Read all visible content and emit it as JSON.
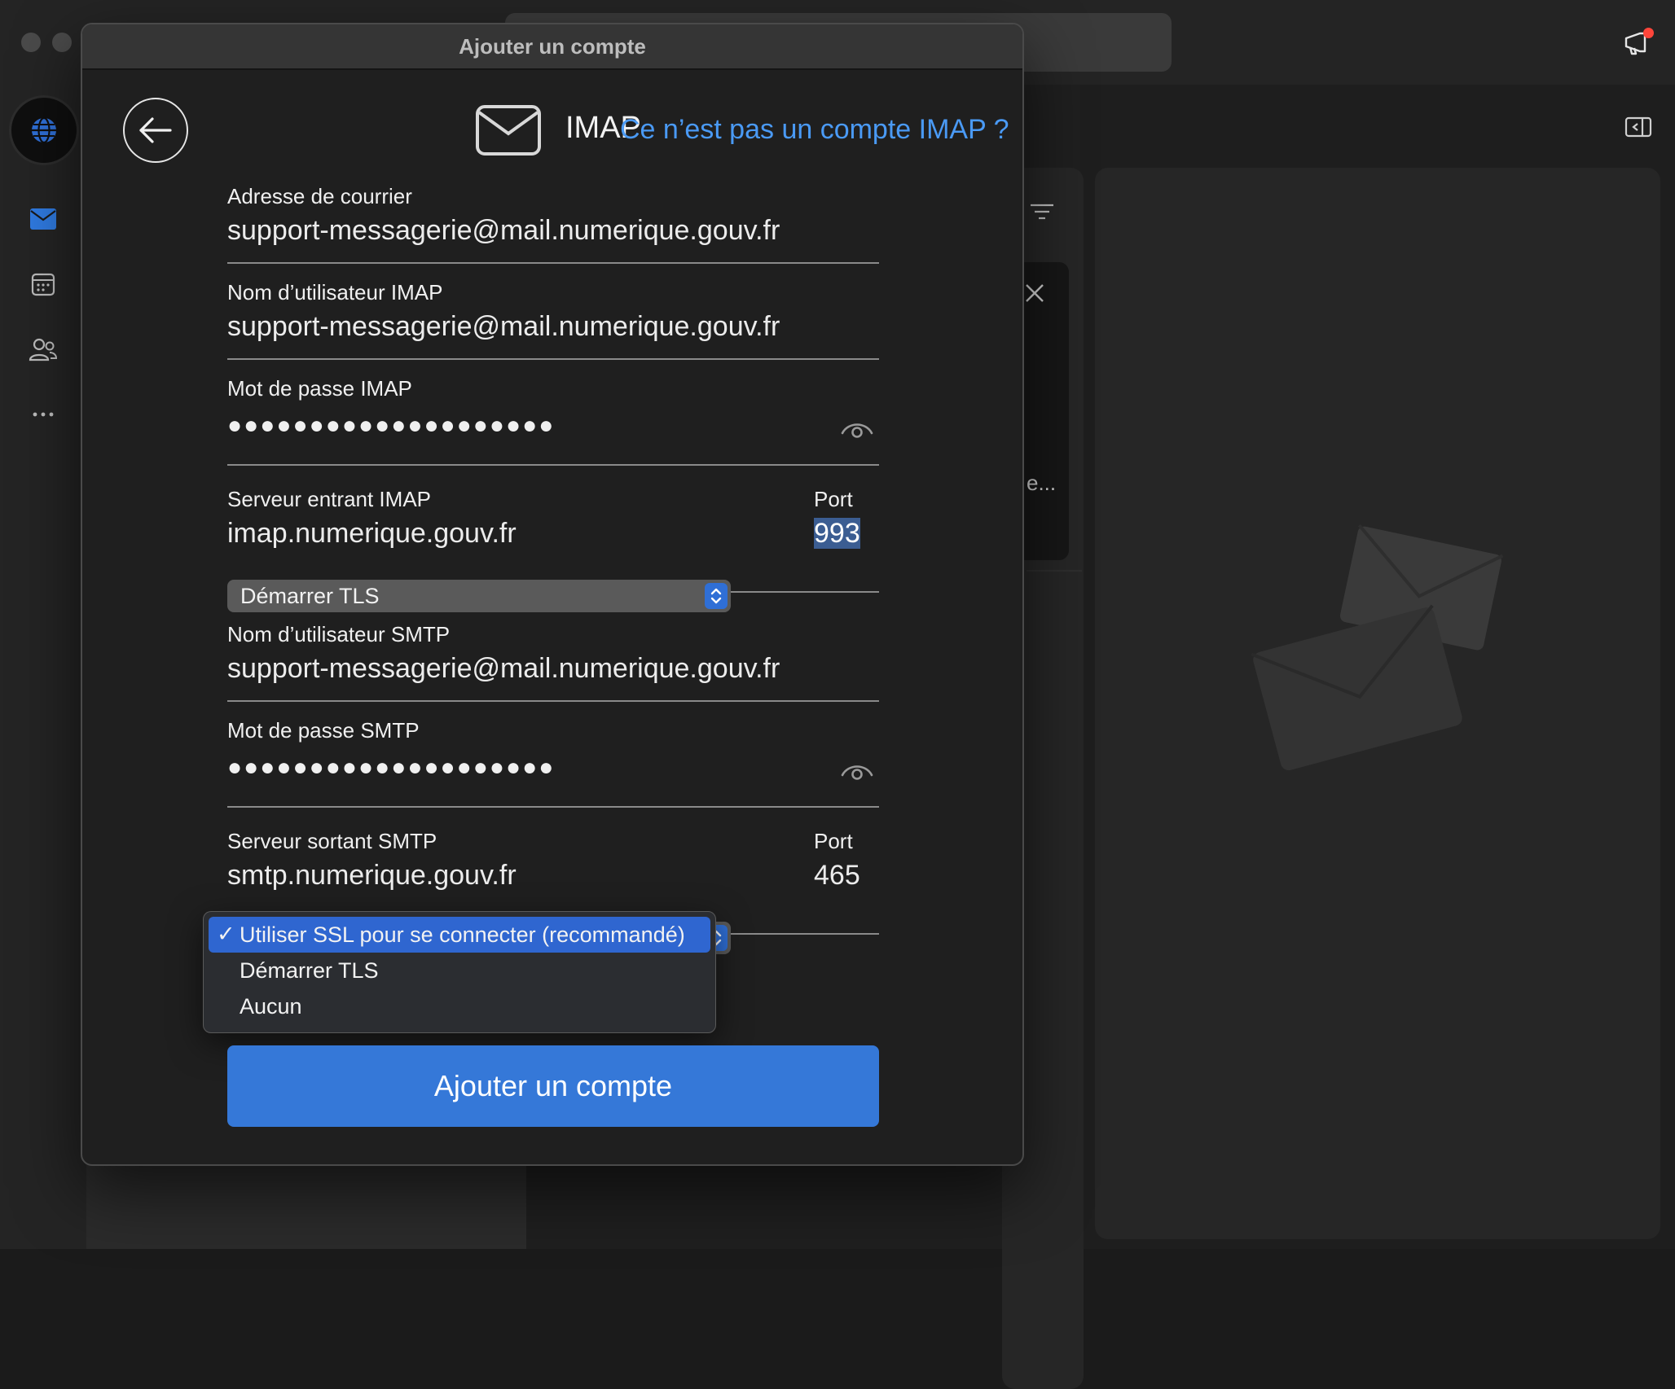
{
  "dialog": {
    "title": "Ajouter un compte",
    "protocol_label": "IMAP",
    "not_imap_link": "Ce n’est pas un compte IMAP ?",
    "email": {
      "label": "Adresse de courrier",
      "value": "support-messagerie@mail.numerique.gouv.fr"
    },
    "imap_username": {
      "label": "Nom d’utilisateur IMAP",
      "value": "support-messagerie@mail.numerique.gouv.fr"
    },
    "imap_password": {
      "label": "Mot de passe IMAP",
      "masked": "●●●●●●●●●●●●●●●●●●●●"
    },
    "imap_server": {
      "label": "Serveur entrant IMAP",
      "value": "imap.numerique.gouv.fr",
      "port_label": "Port",
      "port_value": "993"
    },
    "imap_security": {
      "selected": "Démarrer TLS"
    },
    "smtp_username": {
      "label": "Nom d’utilisateur SMTP",
      "value": "support-messagerie@mail.numerique.gouv.fr"
    },
    "smtp_password": {
      "label": "Mot de passe SMTP",
      "masked": "●●●●●●●●●●●●●●●●●●●●"
    },
    "smtp_server": {
      "label": "Serveur sortant SMTP",
      "value": "smtp.numerique.gouv.fr",
      "port_label": "Port",
      "port_value": "465"
    },
    "smtp_security": {
      "check_mark": "✓",
      "options": [
        "Utiliser SSL pour se connecter (recommandé)",
        "Démarrer TLS",
        "Aucun"
      ],
      "selected_index": 0
    },
    "submit_label": "Ajouter un compte"
  },
  "background": {
    "list_truncated_text": "e..."
  },
  "colors": {
    "accent": "#3578d8",
    "link": "#4a9af5",
    "selection": "#2f66d0",
    "notification_dot": "#ff453a"
  },
  "icons": [
    "globe-icon",
    "mail-icon",
    "calendar-icon",
    "people-icon",
    "more-icon",
    "megaphone-icon",
    "sidebar-toggle-icon",
    "filter-icon",
    "close-icon",
    "envelope-icon",
    "back-arrow-icon",
    "eye-icon",
    "chevron-updown-icon",
    "checkmark-icon"
  ]
}
